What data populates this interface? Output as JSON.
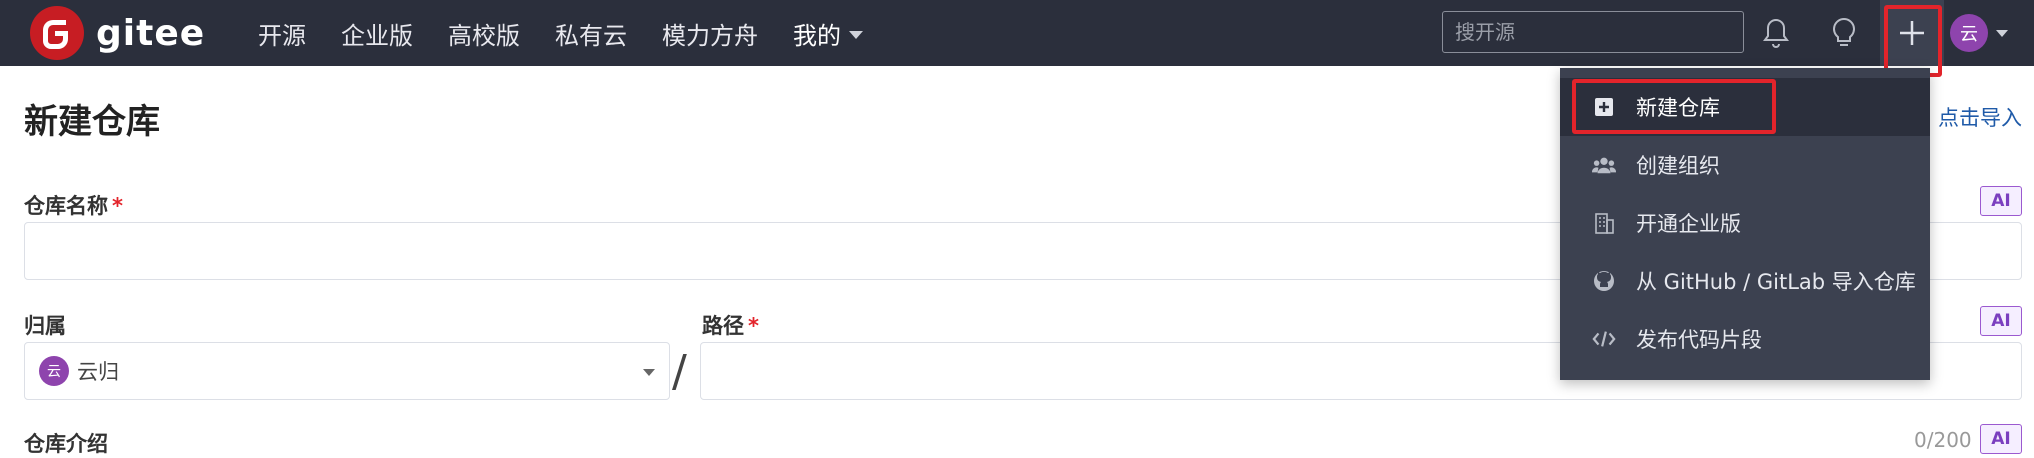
{
  "header": {
    "logo_text": "gitee",
    "nav": [
      "开源",
      "企业版",
      "高校版",
      "私有云",
      "模力方舟"
    ],
    "mine_label": "我的",
    "search_placeholder": "搜开源",
    "avatar_text": "云"
  },
  "page": {
    "title": "新建仓库",
    "import_link": "点击导入"
  },
  "form": {
    "repo_name_label": "仓库名称",
    "required_mark": "*",
    "owner_label": "归属",
    "owner_avatar": "云",
    "owner_value": "云归",
    "path_label": "路径",
    "path_separator": "/",
    "intro_label": "仓库介绍",
    "intro_counter": "0/200",
    "ai_label": "AI"
  },
  "menu": {
    "items": [
      {
        "label": "新建仓库",
        "icon": "plus-square-icon",
        "active": true
      },
      {
        "label": "创建组织",
        "icon": "users-icon"
      },
      {
        "label": "开通企业版",
        "icon": "building-icon"
      },
      {
        "label": "从 GitHub / GitLab 导入仓库",
        "icon": "github-icon"
      },
      {
        "label": "发布代码片段",
        "icon": "code-icon"
      }
    ]
  },
  "colors": {
    "topbar": "#2b2f3c",
    "menu_bg": "#3c4150",
    "brand_red": "#c71d23",
    "highlight": "#e3242b",
    "ai_purple": "#7b3fbf"
  }
}
